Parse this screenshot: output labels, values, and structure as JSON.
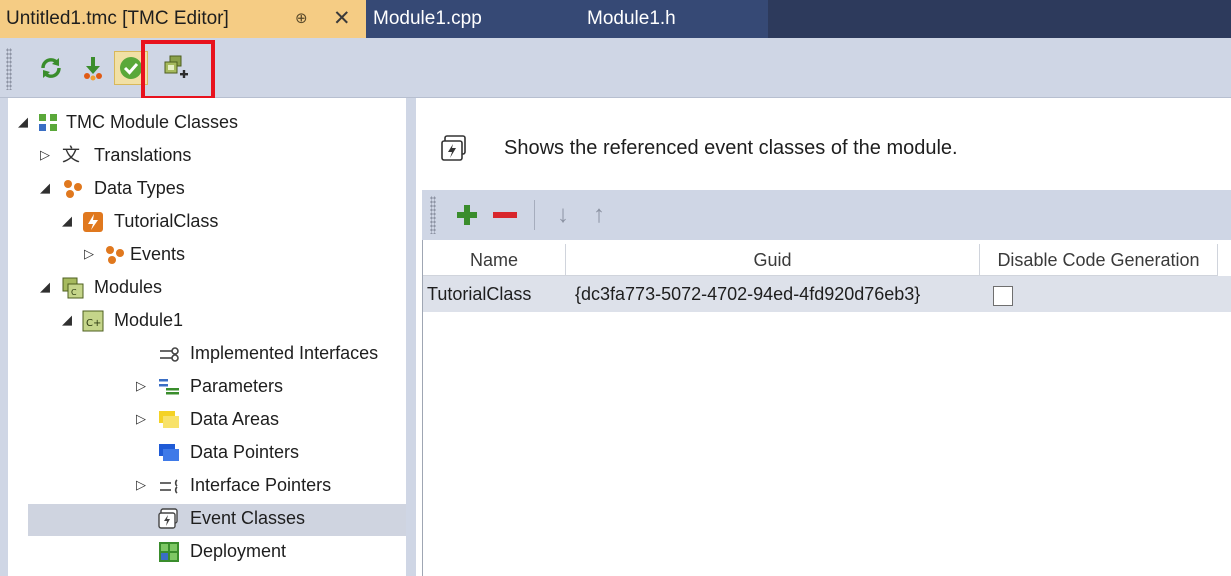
{
  "tabs": {
    "active": "Untitled1.tmc [TMC Editor]",
    "pin_glyph": "⊕",
    "close_glyph": "✕",
    "second": "Module1.cpp",
    "third": "Module1.h"
  },
  "toolbar": {
    "icons": [
      "refresh-icon",
      "download-icon",
      "check-icon",
      "add-event-class-icon"
    ]
  },
  "tree": {
    "root": "TMC Module Classes",
    "translations": "Translations",
    "data_types": "Data Types",
    "tutorial_class": "TutorialClass",
    "events": "Events",
    "modules": "Modules",
    "module1": "Module1",
    "implemented_interfaces": "Implemented Interfaces",
    "parameters": "Parameters",
    "data_areas": "Data Areas",
    "data_pointers": "Data Pointers",
    "interface_pointers": "Interface Pointers",
    "event_classes": "Event Classes",
    "deployment": "Deployment"
  },
  "content": {
    "description": "Shows the referenced event classes of the module.",
    "columns": [
      "Name",
      "Guid",
      "Disable Code Generation"
    ],
    "rows": [
      {
        "name": "TutorialClass",
        "guid": "{dc3fa773-5072-4702-94ed-4fd920d76eb3}",
        "disable_code_generation": false
      }
    ]
  },
  "colors": {
    "active_tab": "#f5cc84",
    "tab_strip": "#2d3a5c",
    "toolbar": "#cfd6e5",
    "selection": "#cfd4e0",
    "highlight": "#e8121d"
  }
}
